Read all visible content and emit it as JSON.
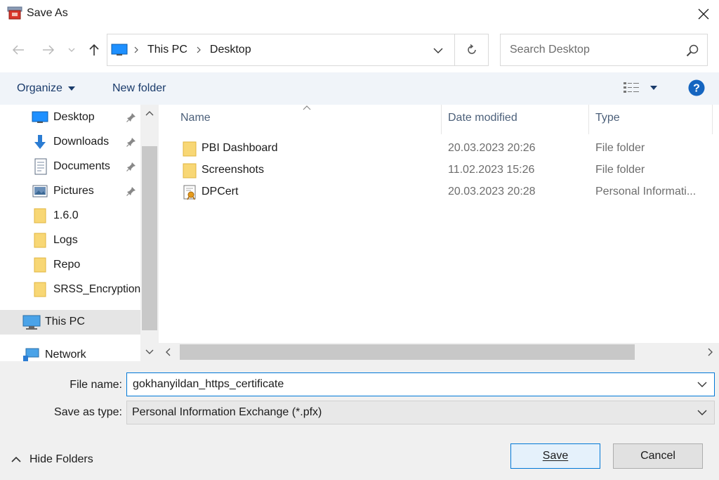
{
  "window": {
    "title": "Save As"
  },
  "address": {
    "breadcrumb": [
      "This PC",
      "Desktop"
    ]
  },
  "search": {
    "placeholder": "Search Desktop"
  },
  "toolbar": {
    "organize": "Organize",
    "new_folder": "New folder"
  },
  "nav": {
    "items": [
      {
        "label": "Desktop",
        "icon": "desktop-icon",
        "pinned": true
      },
      {
        "label": "Downloads",
        "icon": "download-arrow-icon",
        "pinned": true
      },
      {
        "label": "Documents",
        "icon": "documents-icon",
        "pinned": true
      },
      {
        "label": "Pictures",
        "icon": "pictures-icon",
        "pinned": true
      },
      {
        "label": "1.6.0",
        "icon": "folder-icon",
        "pinned": false
      },
      {
        "label": "Logs",
        "icon": "folder-icon",
        "pinned": false
      },
      {
        "label": "Repo",
        "icon": "folder-icon",
        "pinned": false
      },
      {
        "label": "SRSS_Encryption",
        "icon": "folder-icon",
        "pinned": false
      }
    ],
    "this_pc": "This PC",
    "network": "Network"
  },
  "columns": {
    "name": "Name",
    "date": "Date modified",
    "type": "Type"
  },
  "files": [
    {
      "name": "PBI Dashboard",
      "date": "20.03.2023 20:26",
      "type": "File folder",
      "icon": "folder-icon"
    },
    {
      "name": "Screenshots",
      "date": "11.02.2023 15:26",
      "type": "File folder",
      "icon": "folder-icon"
    },
    {
      "name": "DPCert",
      "date": "20.03.2023 20:28",
      "type": "Personal Informati...",
      "icon": "certificate-icon"
    }
  ],
  "form": {
    "file_name_label": "File name:",
    "file_name_value": "gokhanyildan_https_certificate",
    "save_type_label": "Save as type:",
    "save_type_value": "Personal Information Exchange (*.pfx)"
  },
  "buttons": {
    "save": "Save",
    "cancel": "Cancel",
    "hide_folders": "Hide Folders"
  },
  "colors": {
    "accent": "#0078d7",
    "folder": "#f8d775",
    "toolbar_bg": "#f0f4f9",
    "help": "#1565c0"
  }
}
